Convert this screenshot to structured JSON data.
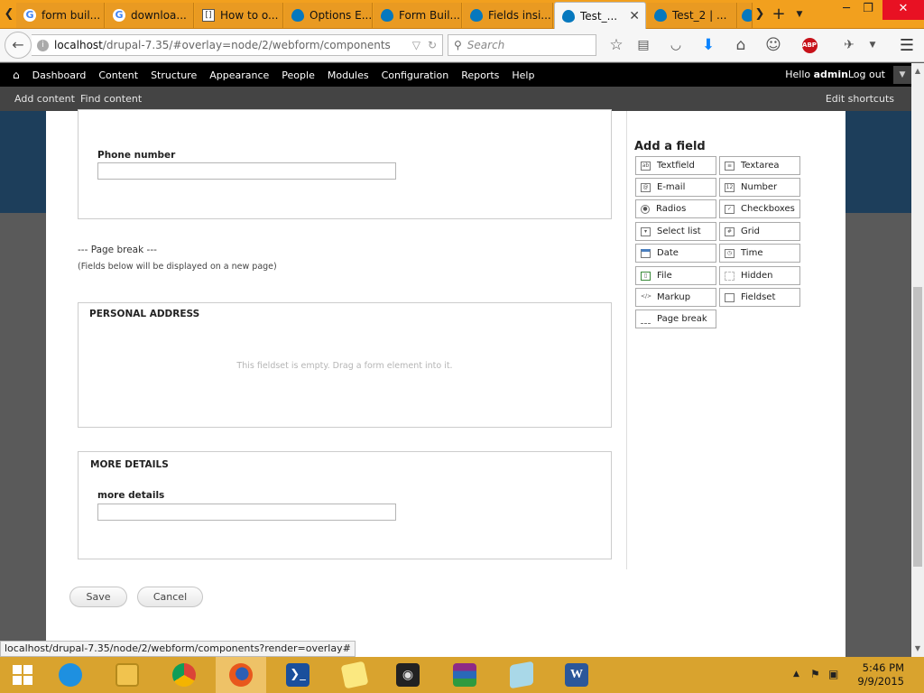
{
  "browser": {
    "tabs": [
      {
        "title": "form buil...",
        "icon": "google-icon"
      },
      {
        "title": "downloa...",
        "icon": "google-icon"
      },
      {
        "title": "How to o...",
        "icon": "bracket-icon"
      },
      {
        "title": "Options E...",
        "icon": "drupal-icon"
      },
      {
        "title": "Form Buil...",
        "icon": "drupal-icon"
      },
      {
        "title": "Fields insi...",
        "icon": "drupal-icon"
      },
      {
        "title": "Test_...",
        "icon": "drupal-icon",
        "active": true
      },
      {
        "title": "Test_2 | ...",
        "icon": "drupal-icon"
      }
    ],
    "url_host": "localhost",
    "url_rest": "/drupal-7.35/#overlay=node/2/webform/components",
    "search_placeholder": "Search",
    "status_url": "localhost/drupal-7.35/node/2/webform/components?render=overlay#"
  },
  "toolbar": {
    "items": [
      "Dashboard",
      "Content",
      "Structure",
      "Appearance",
      "People",
      "Modules",
      "Configuration",
      "Reports",
      "Help"
    ],
    "hello": "Hello ",
    "username": "admin",
    "logout": "Log out"
  },
  "shortcuts": {
    "add_content": "Add content",
    "find_content": "Find content",
    "edit_shortcuts": "Edit shortcuts"
  },
  "form": {
    "phone_label": "Phone number",
    "page_break_title": "--- Page break ---",
    "page_break_desc": "(Fields below will be displayed on a new page)",
    "personal_address_legend": "PERSONAL ADDRESS",
    "empty_fieldset_msg": "This fieldset is empty. Drag a form element into it.",
    "more_details_legend": "MORE DETAILS",
    "more_details_label": "more details",
    "save_label": "Save",
    "cancel_label": "Cancel"
  },
  "palette": {
    "title": "Add a field",
    "items": [
      {
        "label": "Textfield",
        "icon": "textfield-icon"
      },
      {
        "label": "Textarea",
        "icon": "textarea-icon"
      },
      {
        "label": "E-mail",
        "icon": "email-icon"
      },
      {
        "label": "Number",
        "icon": "number-icon"
      },
      {
        "label": "Radios",
        "icon": "radios-icon"
      },
      {
        "label": "Checkboxes",
        "icon": "checkboxes-icon"
      },
      {
        "label": "Select list",
        "icon": "select-list-icon"
      },
      {
        "label": "Grid",
        "icon": "grid-icon"
      },
      {
        "label": "Date",
        "icon": "date-icon"
      },
      {
        "label": "Time",
        "icon": "time-icon"
      },
      {
        "label": "File",
        "icon": "file-icon"
      },
      {
        "label": "Hidden",
        "icon": "hidden-icon"
      },
      {
        "label": "Markup",
        "icon": "markup-icon"
      },
      {
        "label": "Fieldset",
        "icon": "fieldset-icon"
      },
      {
        "label": "Page break",
        "icon": "page-break-icon"
      }
    ]
  },
  "taskbar": {
    "time": "5:46 PM",
    "date": "9/9/2015",
    "apps": [
      "internet-explorer-icon",
      "file-explorer-icon",
      "chrome-icon",
      "firefox-icon",
      "powershell-icon",
      "sticky-notes-icon",
      "media-icon",
      "winrar-icon",
      "notepad-icon",
      "word-icon"
    ]
  },
  "colors": {
    "firefox_chrome": "#f2a01e",
    "drupal_toolbar": "#000000",
    "shortcut_bar": "#444444",
    "drupal_blue": "#0678be",
    "taskbar": "#d9a32e"
  }
}
